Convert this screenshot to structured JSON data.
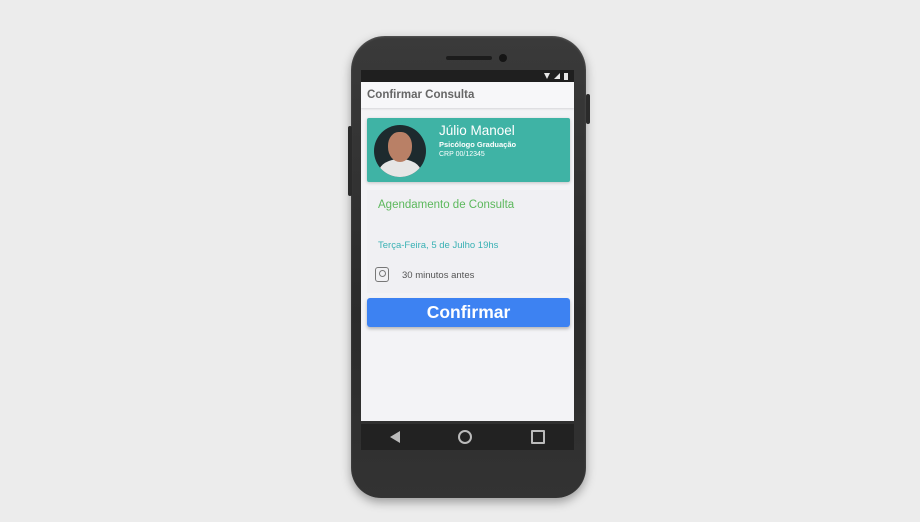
{
  "app": {
    "title": "Confirmar Consulta"
  },
  "doctor": {
    "name": "Júlio Manoel",
    "specialty": "Psicólogo Graduação",
    "registration": "CRP 00/12345"
  },
  "appointment": {
    "title": "Agendamento de Consulta",
    "datetime": "Terça-Feira, 5 de Julho 19hs",
    "reminder": "30 minutos antes"
  },
  "actions": {
    "confirm_label": "Confirmar"
  },
  "colors": {
    "profile_card": "#3fb3a5",
    "appointment_title": "#5cb85c",
    "appointment_date": "#39b1b4",
    "confirm_button": "#3d82f2"
  },
  "icons": {
    "status": [
      "wifi-icon",
      "signal-icon",
      "battery-icon"
    ],
    "reminder": "alarm-icon",
    "nav": [
      "back-icon",
      "home-icon",
      "recent-apps-icon"
    ]
  }
}
